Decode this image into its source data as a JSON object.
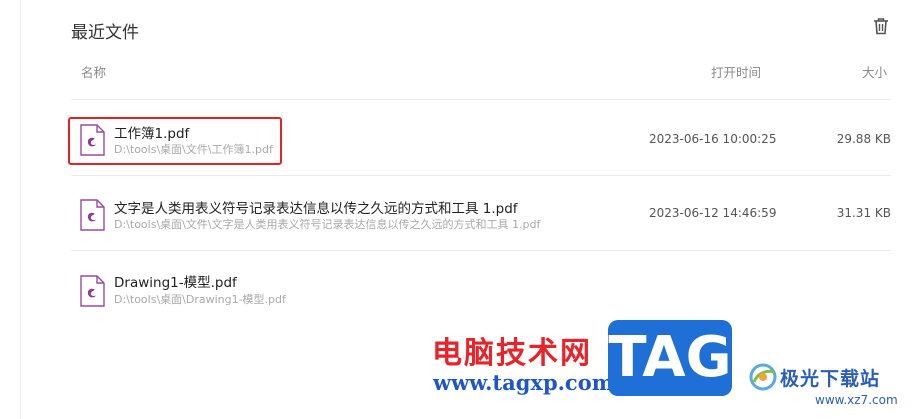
{
  "panel": {
    "title": "最近文件",
    "trash_icon": "trash-icon"
  },
  "columns": {
    "name": "名称",
    "time": "打开时间",
    "size": "大小"
  },
  "files": [
    {
      "name": "工作簿1.pdf",
      "path": "D:\\tools\\桌面\\文件\\工作簿1.pdf",
      "time": "2023-06-16 10:00:25",
      "size": "29.88 KB",
      "icon": "pdf-file-icon",
      "highlighted": true
    },
    {
      "name": "文字是人类用表义符号记录表达信息以传之久远的方式和工具 1.pdf",
      "path": "D:\\tools\\桌面\\文件\\文字是人类用表义符号记录表达信息以传之久远的方式和工具 1.pdf",
      "time": "2023-06-12 14:46:59",
      "size": "31.31 KB",
      "icon": "pdf-file-icon"
    },
    {
      "name": "Drawing1-模型.pdf",
      "path": "D:\\tools\\桌面\\Drawing1-模型.pdf",
      "time": "",
      "size": "",
      "icon": "pdf-file-icon"
    }
  ],
  "watermark": {
    "site_name_cn": "电脑技术网",
    "site_url": "www.tagxp.com",
    "tag": "TAG",
    "brand_cn": "极光下载站",
    "brand_url": "www.xz7.com"
  },
  "colors": {
    "pdf_accent": "#8e3a8f",
    "highlight_border": "#e02424",
    "tag_blue": "#1e6fd6"
  }
}
